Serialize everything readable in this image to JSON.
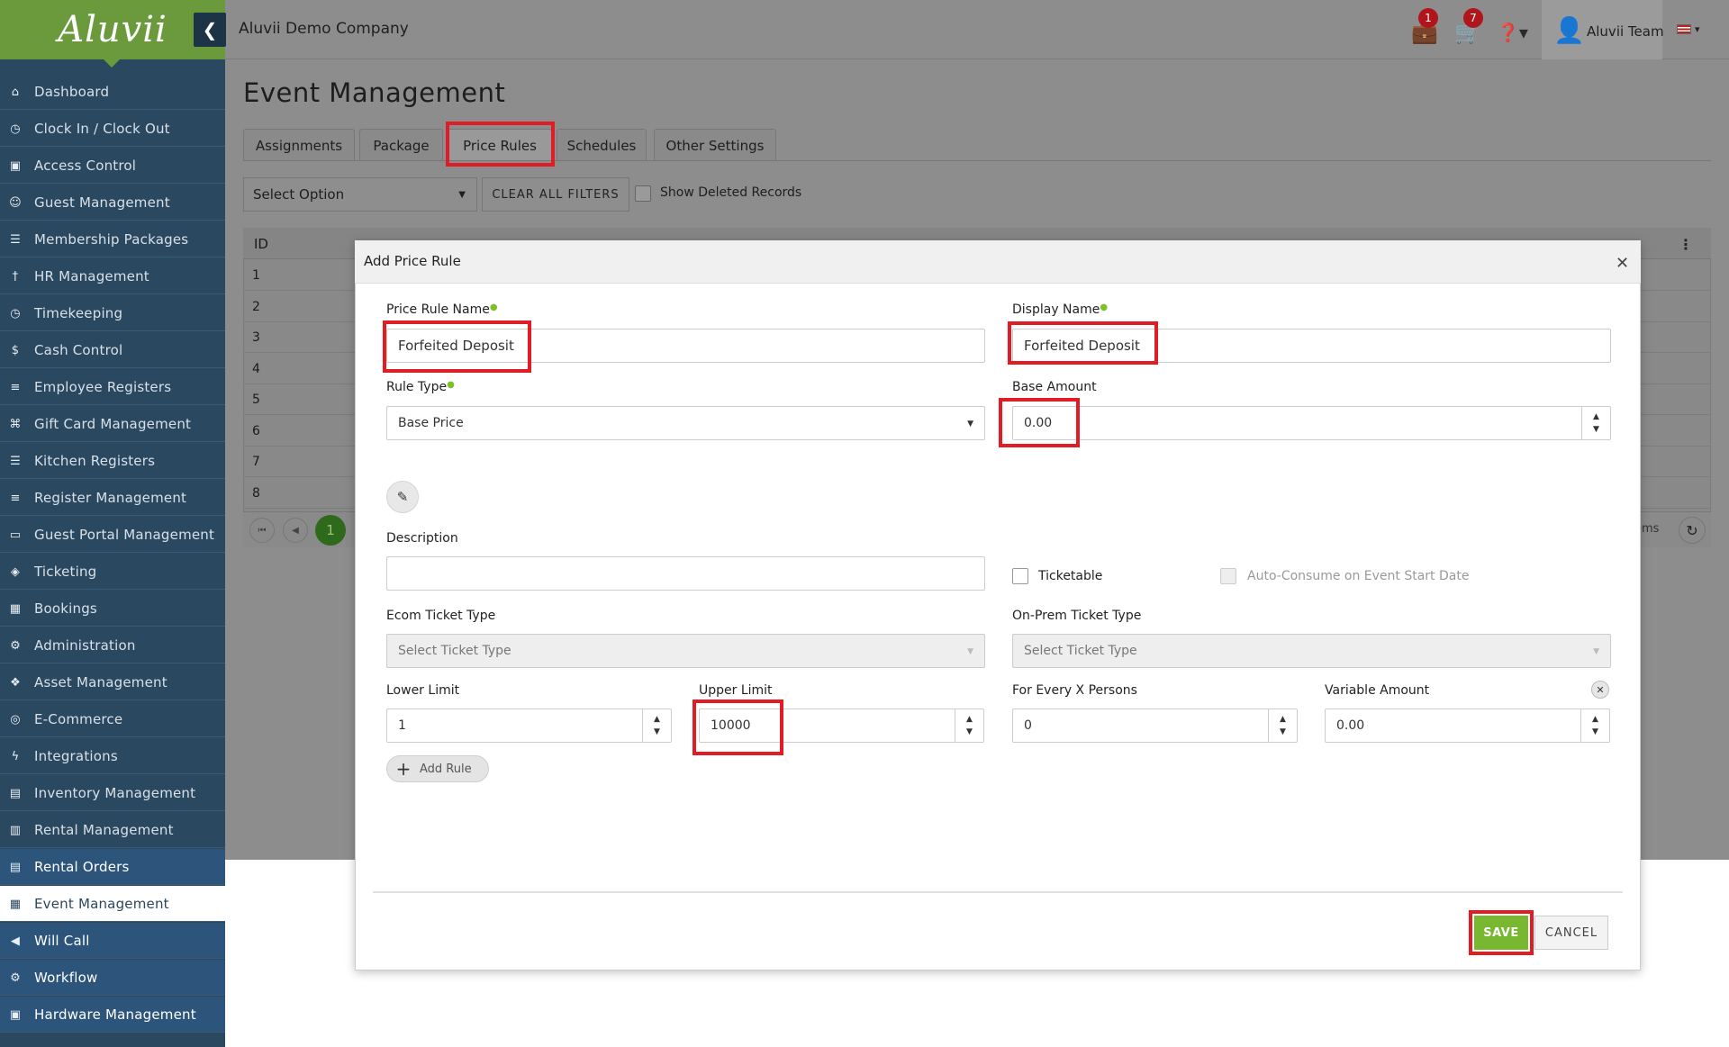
{
  "brand": {
    "logo_text": "Aluvii"
  },
  "header": {
    "company": "Aluvii Demo Company",
    "notifications_count": "1",
    "cart_count": "7",
    "user_name": "Aluvii Team"
  },
  "sidebar": {
    "items": [
      {
        "label": "Dashboard",
        "icon": "home-icon"
      },
      {
        "label": "Clock In / Clock Out",
        "icon": "clock-icon"
      },
      {
        "label": "Access Control",
        "icon": "lock-icon"
      },
      {
        "label": "Guest Management",
        "icon": "users-icon"
      },
      {
        "label": "Membership Packages",
        "icon": "list-icon"
      },
      {
        "label": "HR Management",
        "icon": "user-tie-icon"
      },
      {
        "label": "Timekeeping",
        "icon": "clock-icon"
      },
      {
        "label": "Cash Control",
        "icon": "dollar-icon"
      },
      {
        "label": "Employee Registers",
        "icon": "cart-icon"
      },
      {
        "label": "Gift Card Management",
        "icon": "gift-icon"
      },
      {
        "label": "Kitchen Registers",
        "icon": "list-ul-icon"
      },
      {
        "label": "Register Management",
        "icon": "cart-icon"
      },
      {
        "label": "Guest Portal Management",
        "icon": "laptop-icon"
      },
      {
        "label": "Ticketing",
        "icon": "ticket-icon"
      },
      {
        "label": "Bookings",
        "icon": "calendar-icon"
      },
      {
        "label": "Administration",
        "icon": "cogs-icon"
      },
      {
        "label": "Asset Management",
        "icon": "cubes-icon"
      },
      {
        "label": "E-Commerce",
        "icon": "globe-icon"
      },
      {
        "label": "Integrations",
        "icon": "bolt-icon"
      },
      {
        "label": "Inventory Management",
        "icon": "archive-icon"
      },
      {
        "label": "Rental Management",
        "icon": "clipboard-icon"
      },
      {
        "label": "Rental Orders",
        "icon": "file-icon"
      },
      {
        "label": "Event Management",
        "icon": "calendar-check-icon"
      },
      {
        "label": "Will Call",
        "icon": "bullhorn-icon"
      },
      {
        "label": "Workflow",
        "icon": "gear-icon"
      },
      {
        "label": "Hardware Management",
        "icon": "print-icon"
      }
    ]
  },
  "page": {
    "title": "Event Management",
    "tabs": [
      "Assignments",
      "Package",
      "Price Rules",
      "Schedules",
      "Other Settings"
    ],
    "active_tab": "Price Rules",
    "filter_select": "Select Option",
    "clear_filters": "CLEAR ALL FILTERS",
    "show_deleted": "Show Deleted Records",
    "grid_id_header": "ID",
    "row_ids": [
      "1",
      "2",
      "3",
      "4",
      "5",
      "6",
      "7",
      "8"
    ],
    "current_page": "1",
    "items_fragment": "ems"
  },
  "modal": {
    "title": "Add Price Rule",
    "price_rule_name_label": "Price Rule Name",
    "price_rule_name_value": "Forfeited Deposit",
    "display_name_label": "Display Name",
    "display_name_value": "Forfeited Deposit",
    "rule_type_label": "Rule Type",
    "rule_type_value": "Base Price",
    "base_amount_label": "Base Amount",
    "base_amount_value": "0.00",
    "description_label": "Description",
    "description_value": "",
    "ticketable_label": "Ticketable",
    "auto_consume_label": "Auto-Consume on Event Start Date",
    "ecom_ticket_label": "Ecom Ticket Type",
    "ecom_ticket_value": "Select Ticket Type",
    "onprem_ticket_label": "On-Prem Ticket Type",
    "onprem_ticket_value": "Select Ticket Type",
    "lower_limit_label": "Lower Limit",
    "lower_limit_value": "1",
    "upper_limit_label": "Upper Limit",
    "upper_limit_value": "10000",
    "for_every_label": "For Every X Persons",
    "for_every_value": "0",
    "variable_amount_label": "Variable Amount",
    "variable_amount_value": "0.00",
    "add_rule_label": "Add Rule",
    "save_label": "SAVE",
    "cancel_label": "CANCEL"
  },
  "colors": {
    "sidebar": "#2b4861",
    "brand_green": "#6a9a3c",
    "save_green": "#78b831",
    "highlight_red": "#e01c24"
  }
}
